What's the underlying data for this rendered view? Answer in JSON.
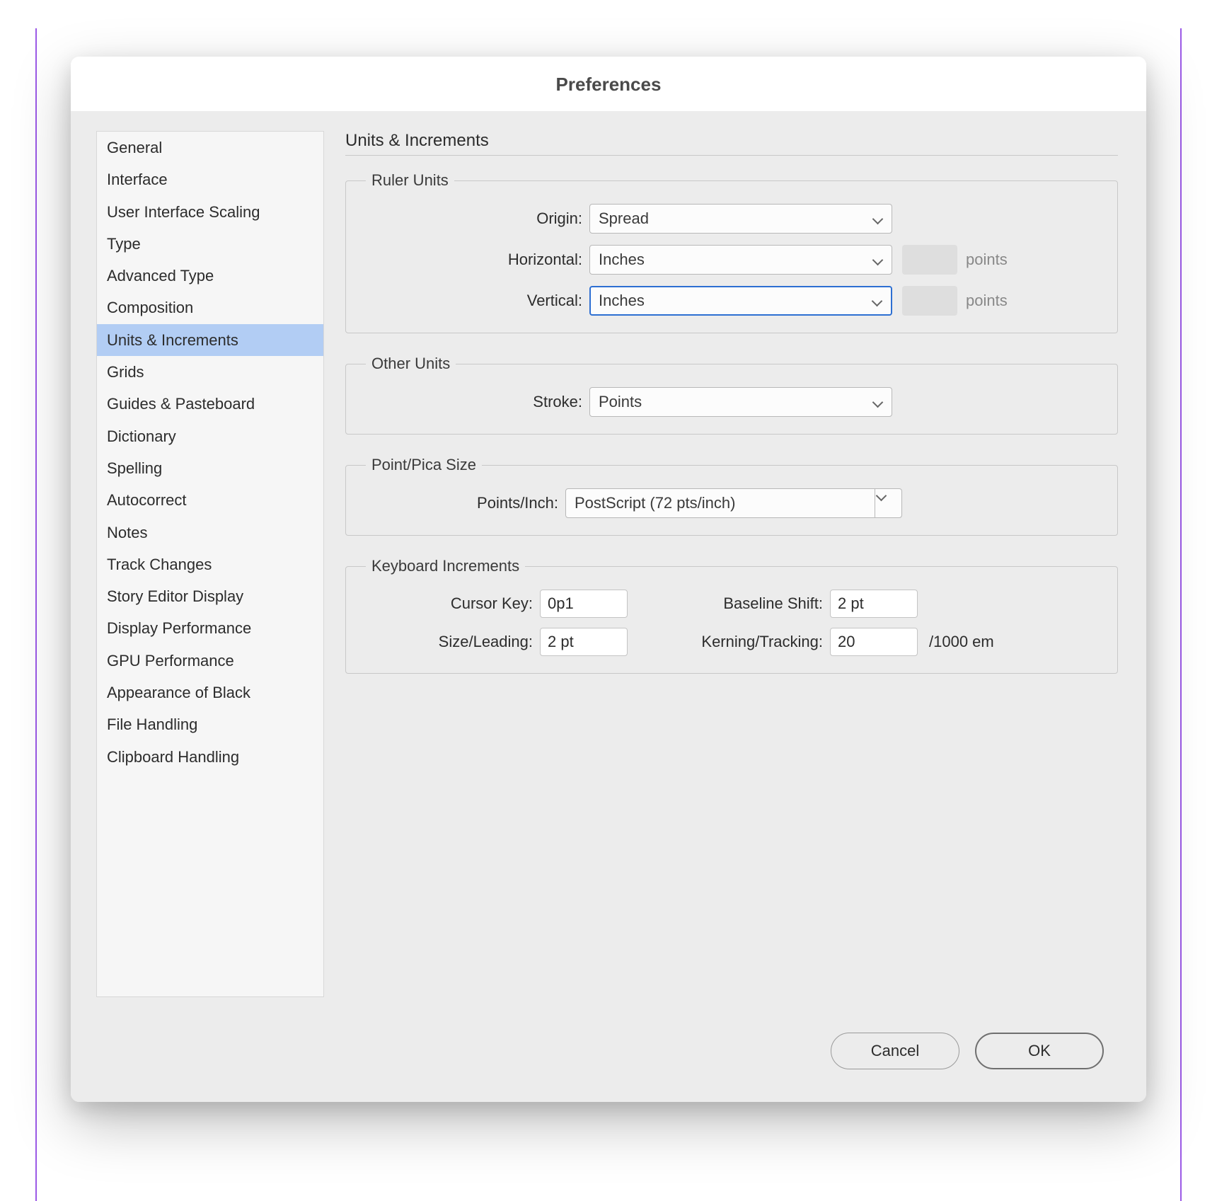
{
  "dialog": {
    "title": "Preferences"
  },
  "sidebar": {
    "items": [
      "General",
      "Interface",
      "User Interface Scaling",
      "Type",
      "Advanced Type",
      "Composition",
      "Units & Increments",
      "Grids",
      "Guides & Pasteboard",
      "Dictionary",
      "Spelling",
      "Autocorrect",
      "Notes",
      "Track Changes",
      "Story Editor Display",
      "Display Performance",
      "GPU Performance",
      "Appearance of Black",
      "File Handling",
      "Clipboard Handling"
    ],
    "selected_index": 6
  },
  "main": {
    "section_title": "Units & Increments",
    "ruler_units": {
      "legend": "Ruler Units",
      "origin_label": "Origin:",
      "origin_value": "Spread",
      "horizontal_label": "Horizontal:",
      "horizontal_value": "Inches",
      "horizontal_suffix": "points",
      "vertical_label": "Vertical:",
      "vertical_value": "Inches",
      "vertical_suffix": "points"
    },
    "other_units": {
      "legend": "Other Units",
      "stroke_label": "Stroke:",
      "stroke_value": "Points"
    },
    "point_pica": {
      "legend": "Point/Pica Size",
      "points_inch_label": "Points/Inch:",
      "points_inch_value": "PostScript (72 pts/inch)"
    },
    "keyboard": {
      "legend": "Keyboard Increments",
      "cursor_key_label": "Cursor Key:",
      "cursor_key_value": "0p1",
      "baseline_shift_label": "Baseline Shift:",
      "baseline_shift_value": "2 pt",
      "size_leading_label": "Size/Leading:",
      "size_leading_value": "2 pt",
      "kerning_label": "Kerning/Tracking:",
      "kerning_value": "20",
      "kerning_suffix": "/1000 em"
    }
  },
  "footer": {
    "cancel": "Cancel",
    "ok": "OK"
  }
}
